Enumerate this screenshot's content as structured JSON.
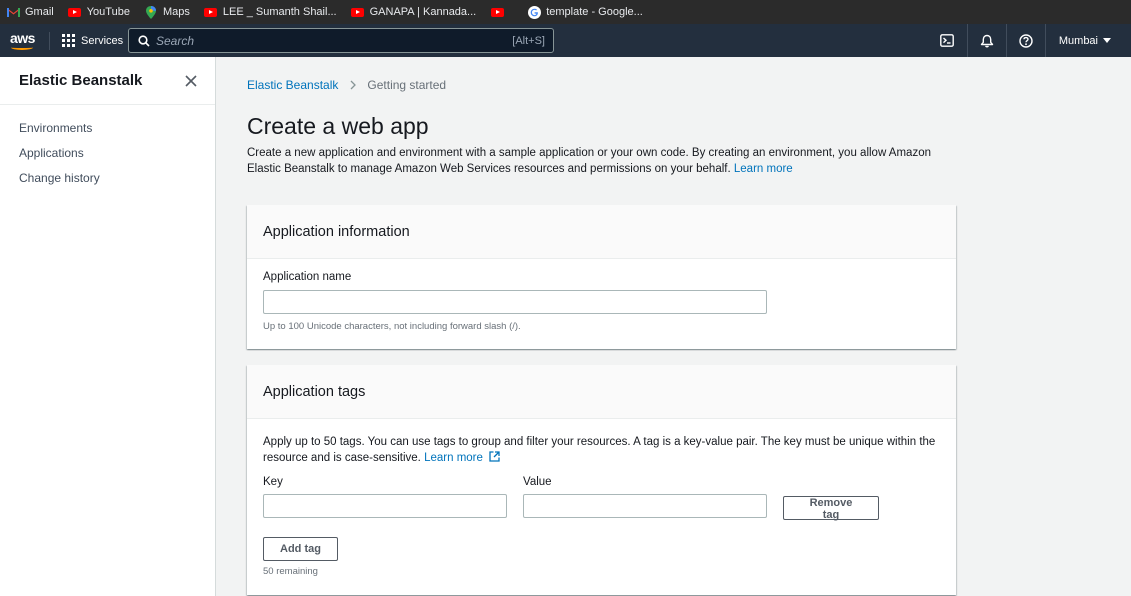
{
  "bookmarks": [
    {
      "label": "Gmail",
      "icon": "gmail-icon"
    },
    {
      "label": "YouTube",
      "icon": "youtube-icon"
    },
    {
      "label": "Maps",
      "icon": "maps-icon"
    },
    {
      "label": "LEE _ Sumanth Shail...",
      "icon": "youtube-icon"
    },
    {
      "label": "GANAPA | Kannada...",
      "icon": "youtube-icon"
    },
    {
      "label": "",
      "icon": "youtube-icon"
    },
    {
      "label": "template - Google...",
      "icon": "google-icon"
    }
  ],
  "topnav": {
    "logo": "aws",
    "services_label": "Services",
    "search_placeholder": "Search",
    "search_shortcut": "[Alt+S]",
    "region_label": "Mumbai",
    "colors": {
      "background": "#232f3e",
      "accent": "#ff9900"
    }
  },
  "sidenav": {
    "title": "Elastic Beanstalk",
    "items": [
      {
        "label": "Environments"
      },
      {
        "label": "Applications"
      },
      {
        "label": "Change history"
      }
    ]
  },
  "breadcrumb": {
    "link": "Elastic Beanstalk",
    "current": "Getting started"
  },
  "page": {
    "title": "Create a web app",
    "description": "Create a new application and environment with a sample application or your own code. By creating an environment, you allow Amazon Elastic Beanstalk to manage Amazon Web Services resources and permissions on your behalf.",
    "learn_more": "Learn more"
  },
  "app_info": {
    "heading": "Application information",
    "name_label": "Application name",
    "name_value": "",
    "name_hint": "Up to 100 Unicode characters, not including forward slash (/)."
  },
  "app_tags": {
    "heading": "Application tags",
    "description": "Apply up to 50 tags. You can use tags to group and filter your resources. A tag is a key-value pair. The key must be unique within the resource and is case-sensitive.",
    "learn_more": "Learn more",
    "key_label": "Key",
    "value_label": "Value",
    "key_value": "",
    "value_value": "",
    "remove_button": "Remove tag",
    "add_button": "Add tag",
    "remaining": "50 remaining"
  }
}
